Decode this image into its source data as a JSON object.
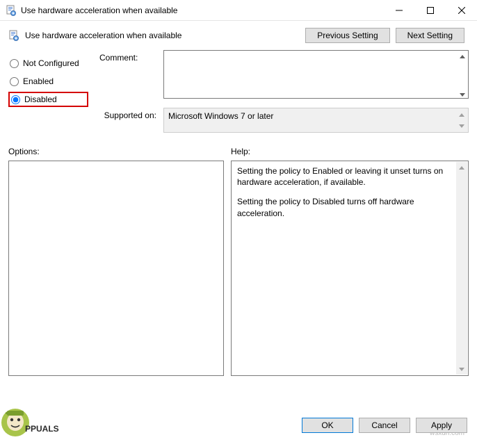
{
  "window": {
    "title": "Use hardware acceleration when available"
  },
  "header": {
    "title": "Use hardware acceleration when available",
    "previous": "Previous Setting",
    "next": "Next Setting"
  },
  "state": {
    "not_configured": "Not Configured",
    "enabled": "Enabled",
    "disabled": "Disabled",
    "selected": "disabled"
  },
  "fields": {
    "comment_label": "Comment:",
    "comment_value": "",
    "supported_label": "Supported on:",
    "supported_value": "Microsoft Windows 7 or later"
  },
  "sections": {
    "options_label": "Options:",
    "help_label": "Help:",
    "help_p1": "Setting the policy to Enabled or leaving it unset turns on hardware acceleration, if available.",
    "help_p2": "Setting the policy to Disabled turns off hardware acceleration."
  },
  "footer": {
    "ok": "OK",
    "cancel": "Cancel",
    "apply": "Apply"
  },
  "watermark": "wsxdn.com",
  "logo_text": "APPUALS"
}
